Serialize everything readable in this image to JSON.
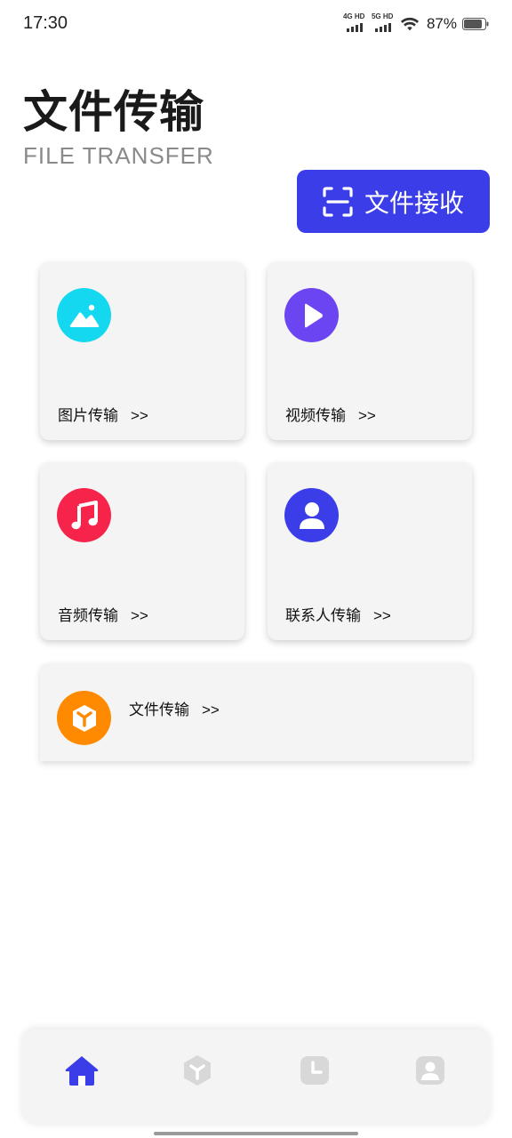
{
  "status_bar": {
    "time": "17:30",
    "network_1": "4G HD",
    "network_2": "5G HD",
    "battery": "87%"
  },
  "header": {
    "title": "文件传输",
    "subtitle": "FILE TRANSFER",
    "receive_button": "文件接收"
  },
  "cards": [
    {
      "label": "图片传输",
      "arrow": ">>",
      "icon": "image-icon",
      "color": "#13d8f0"
    },
    {
      "label": "视频传输",
      "arrow": ">>",
      "icon": "play-icon",
      "color": "#6b45f2"
    },
    {
      "label": "音频传输",
      "arrow": ">>",
      "icon": "music-icon",
      "color": "#f6244a"
    },
    {
      "label": "联系人传输",
      "arrow": ">>",
      "icon": "person-icon",
      "color": "#3b3ee8"
    }
  ],
  "file_card": {
    "label": "文件传输",
    "arrow": ">>",
    "icon": "box-icon",
    "color": "#ff8a00"
  },
  "bottom_nav": [
    {
      "icon": "home-icon",
      "active": true
    },
    {
      "icon": "box-icon",
      "active": false
    },
    {
      "icon": "clock-icon",
      "active": false
    },
    {
      "icon": "profile-icon",
      "active": false
    }
  ],
  "colors": {
    "accent": "#3b3ee8",
    "inactive_icon": "#d8d8d8"
  }
}
